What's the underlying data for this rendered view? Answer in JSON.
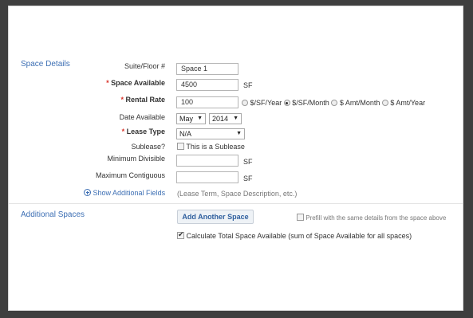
{
  "space_details": {
    "section_title": "Space Details",
    "suite_floor": {
      "label": "Suite/Floor #",
      "value": "Space 1"
    },
    "space_available": {
      "required_mark": "*",
      "label": "Space Available",
      "value": "4500",
      "unit": "SF"
    },
    "rental_rate": {
      "required_mark": "*",
      "label": "Rental Rate",
      "value": "100",
      "options": [
        {
          "label": "$/SF/Year",
          "selected": false
        },
        {
          "label": "$/SF/Month",
          "selected": true
        },
        {
          "label": "$ Amt/Month",
          "selected": false
        },
        {
          "label": "$ Amt/Year",
          "selected": false
        }
      ]
    },
    "date_available": {
      "label": "Date Available",
      "month": "May",
      "year": "2014"
    },
    "lease_type": {
      "required_mark": "*",
      "label": "Lease Type",
      "value": "N/A"
    },
    "sublease": {
      "label": "Sublease?",
      "checkbox_label": "This is a Sublease",
      "checked": false
    },
    "minimum_divisible": {
      "label": "Minimum Divisible",
      "value": "",
      "unit": "SF"
    },
    "maximum_contiguous": {
      "label": "Maximum Contiguous",
      "value": "",
      "unit": "SF"
    },
    "show_additional": {
      "link_label": "Show Additional Fields",
      "hint": "(Lease Term, Space Description, etc.)"
    }
  },
  "additional_spaces": {
    "section_title": "Additional Spaces",
    "add_button": "Add Another Space",
    "prefill": {
      "label": "Prefill with the same details from the space above",
      "checked": false
    },
    "calculate": {
      "label": "Calculate Total Space Available (sum of Space Available for all spaces)",
      "checked": true
    }
  }
}
